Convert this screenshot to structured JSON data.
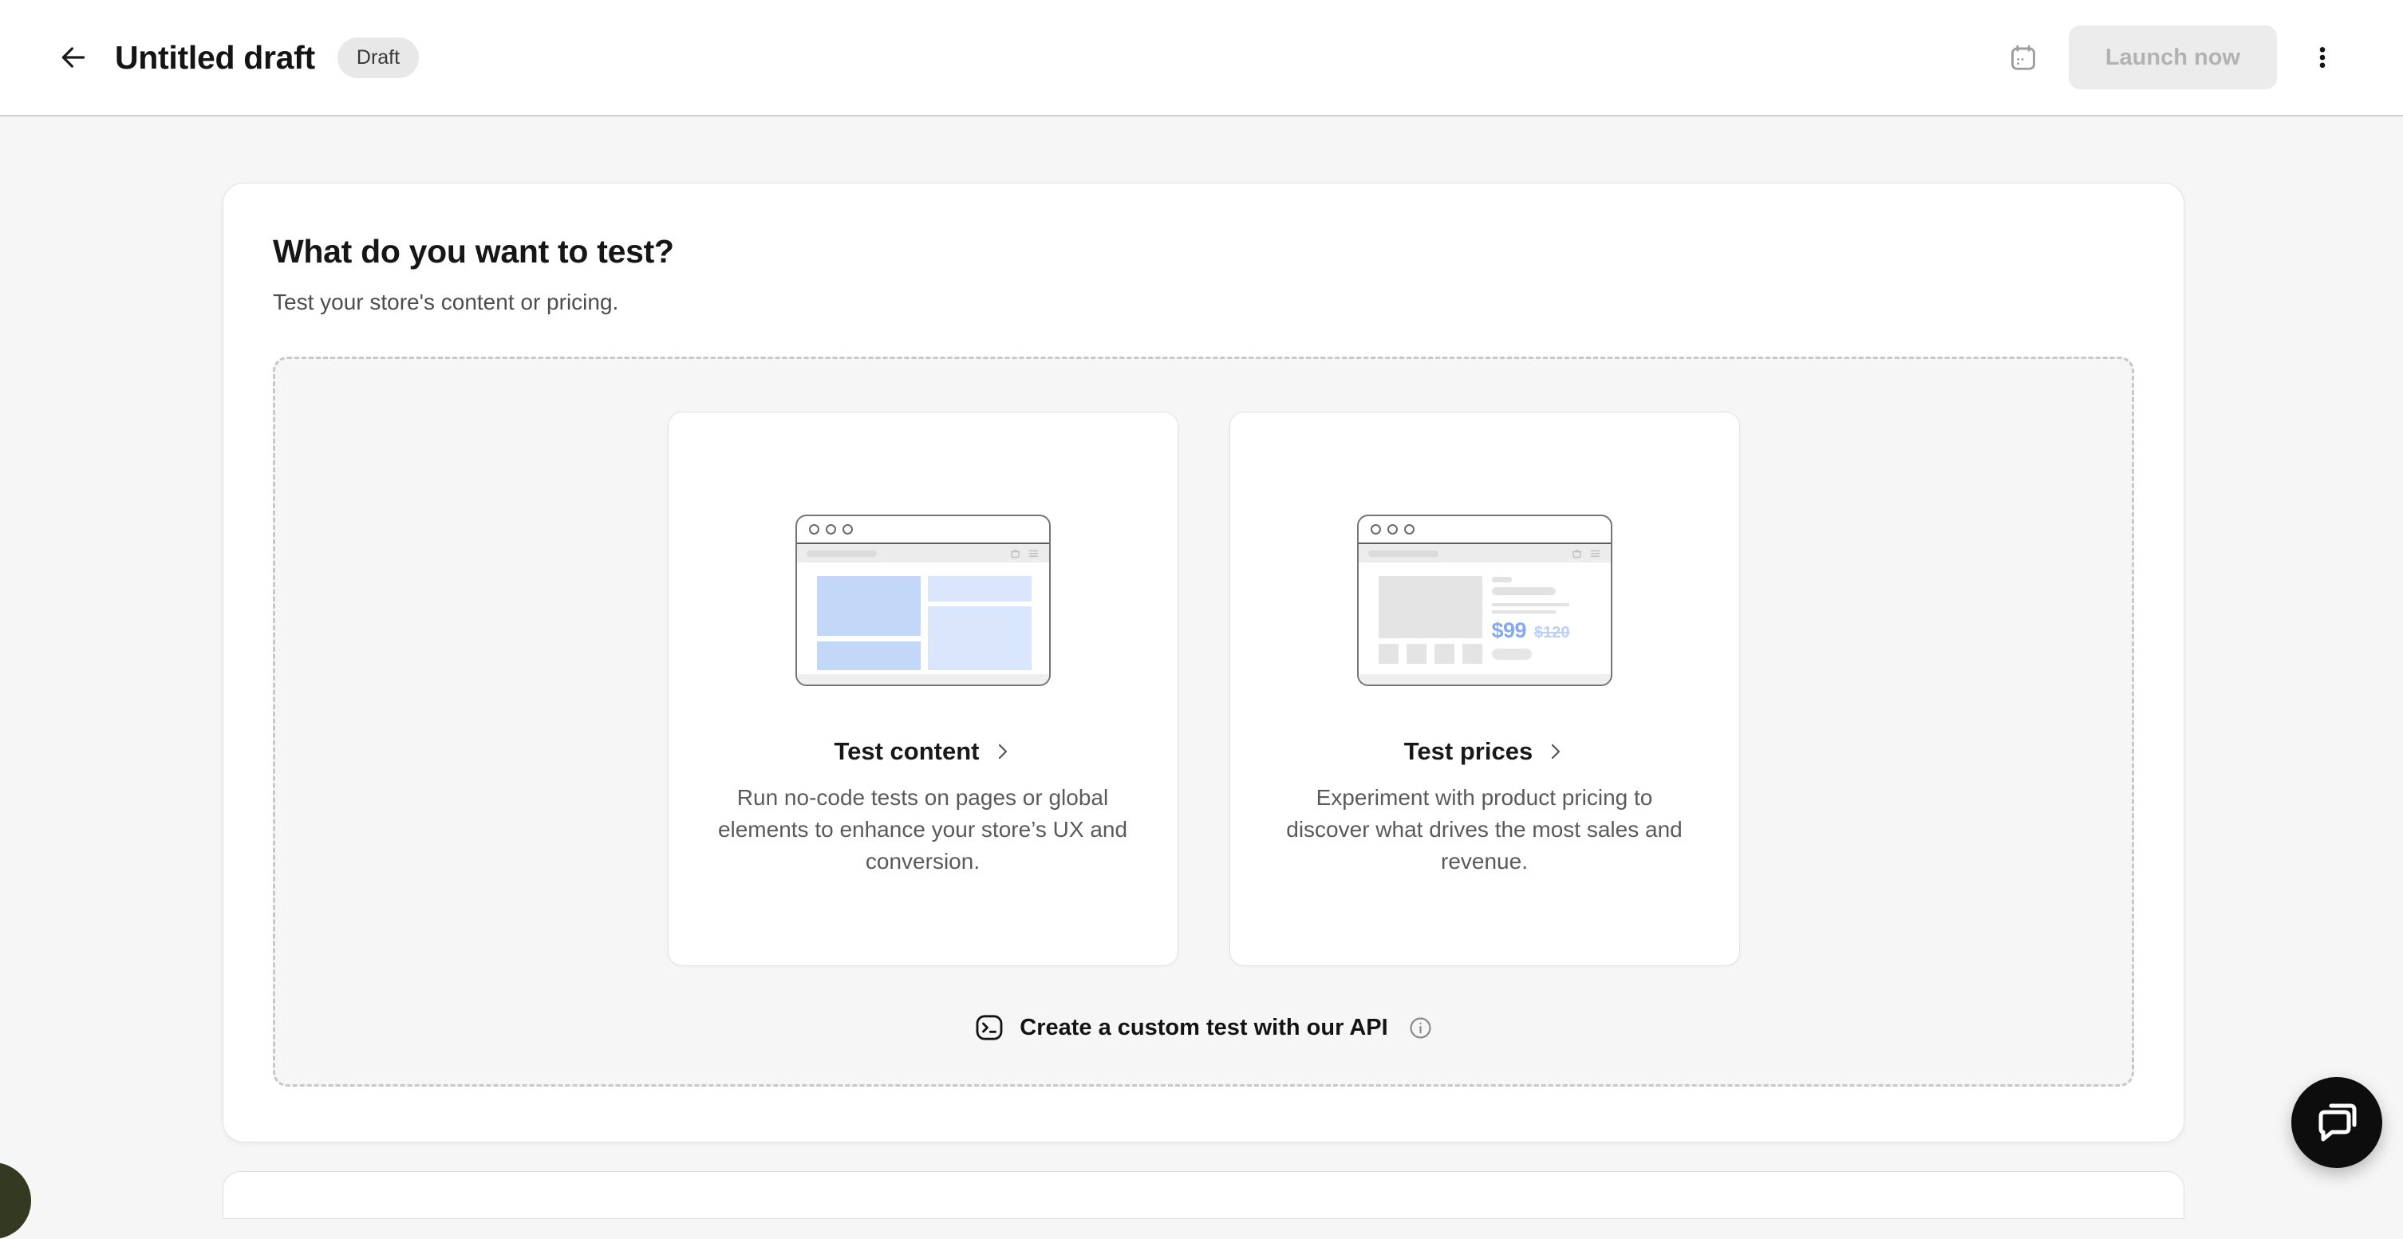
{
  "header": {
    "title": "Untitled draft",
    "status_badge": "Draft",
    "launch_button": "Launch now"
  },
  "main": {
    "heading": "What do you want to test?",
    "subheading": "Test your store's content or pricing.",
    "options": [
      {
        "title": "Test content",
        "description": "Run no-code tests on pages or global elements to enhance your store’s UX and conversion."
      },
      {
        "title": "Test prices",
        "description": "Experiment with product pricing to discover what drives the most sales and revenue.",
        "price_new": "$99",
        "price_old": "$120"
      }
    ],
    "api_cta": "Create a custom test with our API"
  },
  "colors": {
    "accent_blue": "#85a9f1",
    "illustration_blue": "#c3d7f8",
    "illustration_blue_light": "#d9e6fb",
    "chat_fab": "#0d0d0d"
  }
}
